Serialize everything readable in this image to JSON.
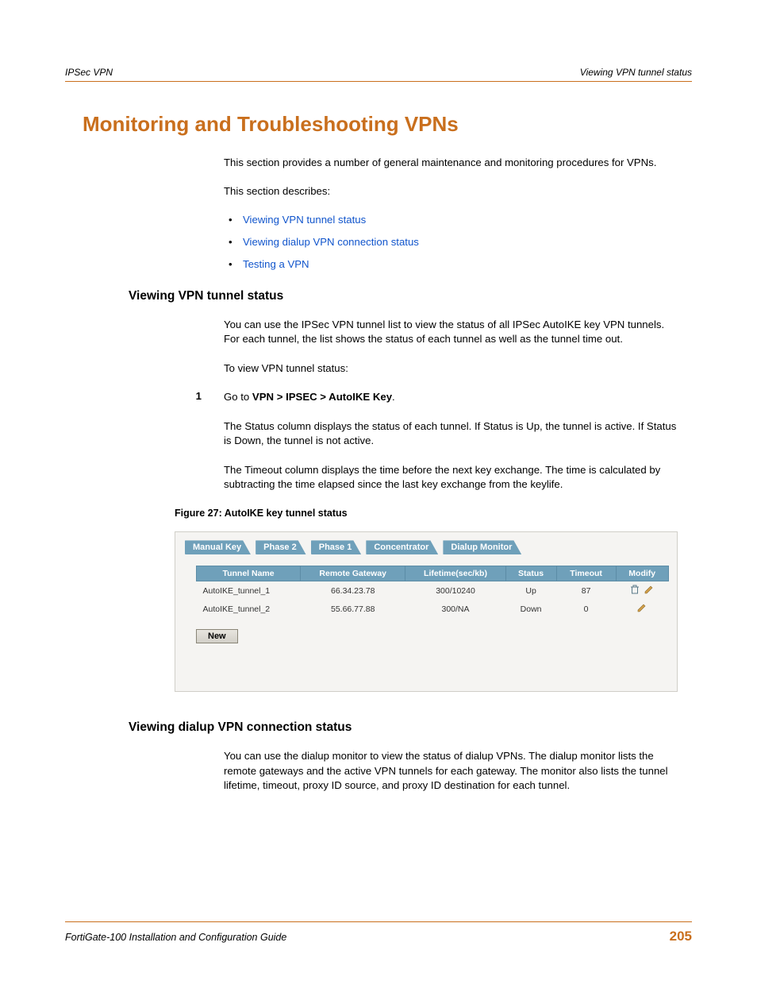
{
  "header": {
    "left": "IPSec VPN",
    "right": "Viewing VPN tunnel status"
  },
  "h1": "Monitoring and Troubleshooting VPNs",
  "intro1": "This section provides a number of general maintenance and monitoring procedures for VPNs.",
  "intro2": "This section describes:",
  "bullets": [
    "Viewing VPN tunnel status",
    "Viewing dialup VPN connection status",
    "Testing a VPN"
  ],
  "sec1": {
    "title": "Viewing VPN tunnel status",
    "p1": "You can use the IPSec VPN tunnel list to view the status of all IPSec AutoIKE key VPN tunnels. For each tunnel, the list shows the status of each tunnel as well as the tunnel time out.",
    "p2": "To view VPN tunnel status:",
    "step_num": "1",
    "step_prefix": "Go to ",
    "step_bold": "VPN > IPSEC > AutoIKE Key",
    "step_suffix": ".",
    "p3": "The Status column displays the status of each tunnel. If Status is Up, the tunnel is active. If Status is Down, the tunnel is not active.",
    "p4": "The Timeout column displays the time before the next key exchange. The time is calculated by subtracting the time elapsed since the last key exchange from the keylife.",
    "fig": "Figure 27: AutoIKE key tunnel status"
  },
  "shot": {
    "tabs": [
      "Manual Key",
      "Phase 2",
      "Phase 1",
      "Concentrator",
      "Dialup Monitor"
    ],
    "headers": [
      "Tunnel Name",
      "Remote Gateway",
      "Lifetime(sec/kb)",
      "Status",
      "Timeout",
      "Modify"
    ],
    "rows": [
      {
        "name": "AutoIKE_tunnel_1",
        "gw": "66.34.23.78",
        "life": "300/10240",
        "status": "Up",
        "timeout": "87",
        "icons": [
          "trash",
          "edit"
        ]
      },
      {
        "name": "AutoIKE_tunnel_2",
        "gw": "55.66.77.88",
        "life": "300/NA",
        "status": "Down",
        "timeout": "0",
        "icons": [
          "edit"
        ]
      }
    ],
    "new_btn": "New"
  },
  "sec2": {
    "title": "Viewing dialup VPN connection status",
    "p1": "You can use the dialup monitor to view the status of dialup VPNs. The dialup monitor lists the remote gateways and the active VPN tunnels for each gateway. The monitor also lists the tunnel lifetime, timeout, proxy ID source, and proxy ID destination for each tunnel."
  },
  "footer": {
    "left": "FortiGate-100 Installation and Configuration Guide",
    "page": "205"
  }
}
